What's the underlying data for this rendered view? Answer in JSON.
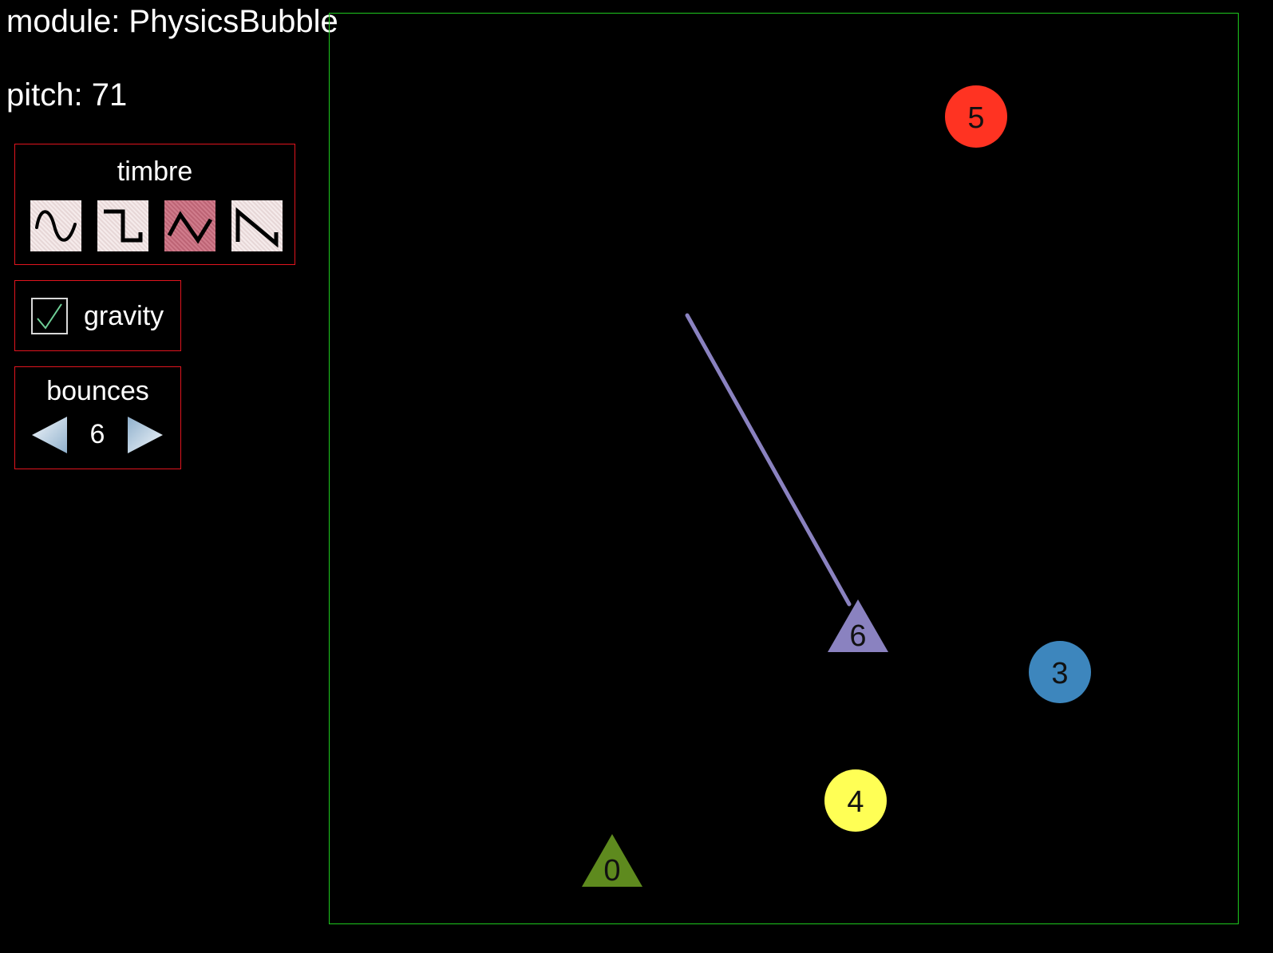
{
  "header": {
    "module": "module: PhysicsBubble",
    "pitch": "pitch: 71"
  },
  "timbre": {
    "title": "timbre",
    "options": [
      "sine-wave-icon",
      "square-wave-icon",
      "triangle-wave-icon",
      "sawtooth-wave-icon"
    ],
    "selected": "triangle-wave-icon"
  },
  "gravity": {
    "label": "gravity",
    "checked": true
  },
  "bounces": {
    "title": "bounces",
    "value": "6",
    "decrease_icon": "left-arrow-icon",
    "increase_icon": "right-arrow-icon"
  },
  "stage": {
    "border_color": "#1ec81e",
    "bubbles": [
      {
        "label": "5",
        "shape": "circle",
        "color": "#ff3322"
      },
      {
        "label": "6",
        "shape": "triangle",
        "color": "#8a82c0"
      },
      {
        "label": "3",
        "shape": "circle",
        "color": "#3d86bd"
      },
      {
        "label": "4",
        "shape": "circle",
        "color": "#ffff55"
      },
      {
        "label": "0",
        "shape": "triangle",
        "color": "#5e8a1e"
      }
    ],
    "aim_line_color": "#8a82c0"
  },
  "colors": {
    "panel_border": "#e0141e",
    "selected_timbre": "#c96a7c"
  }
}
